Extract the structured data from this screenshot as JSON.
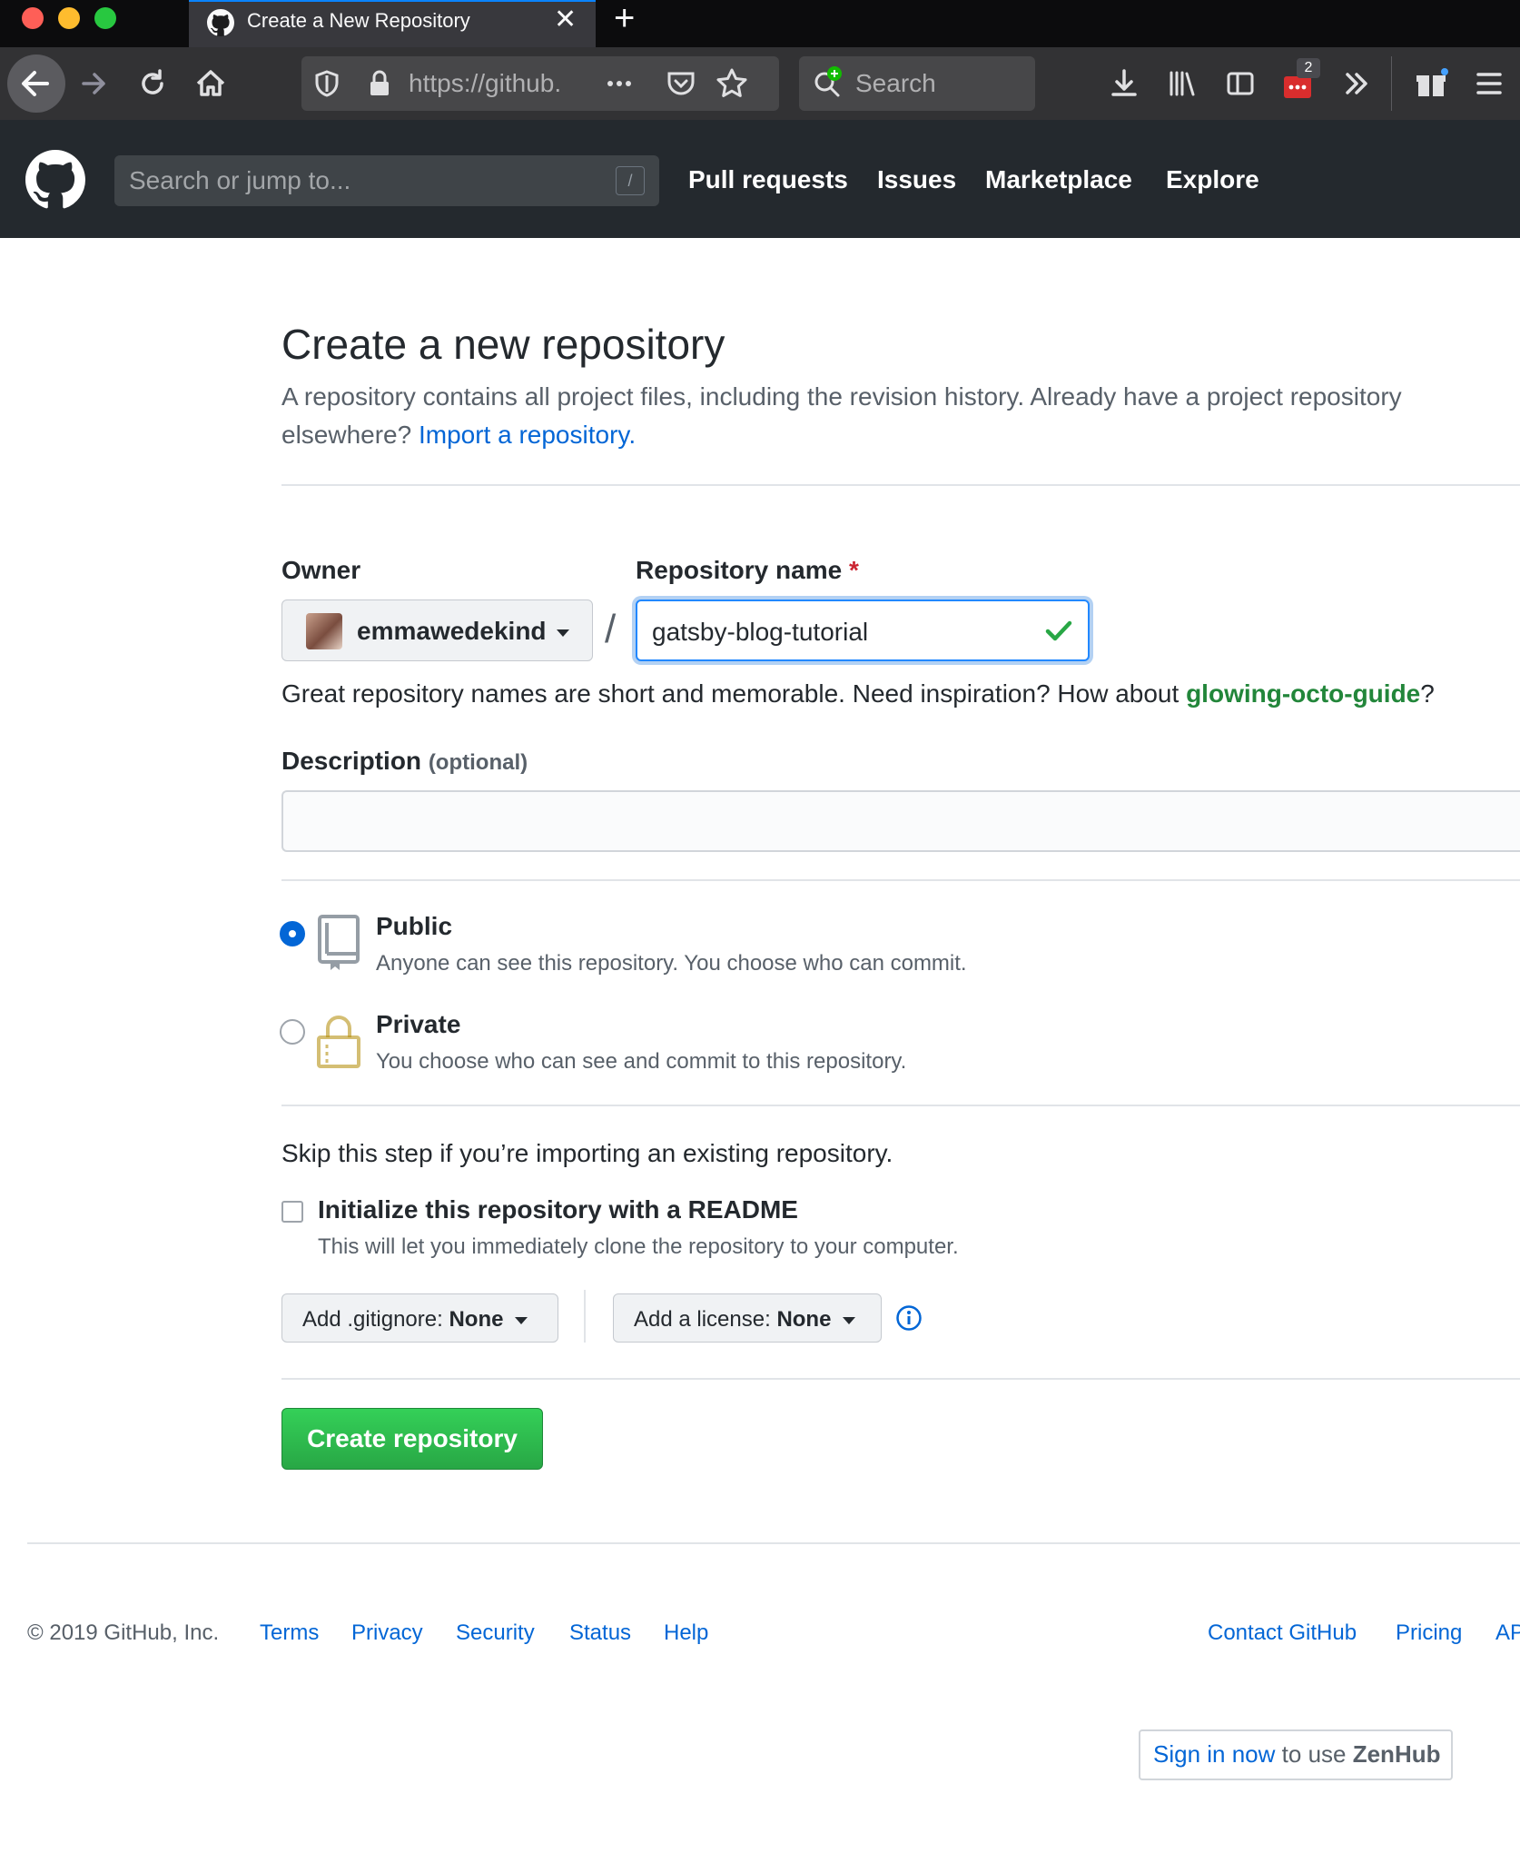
{
  "browser": {
    "tab_title": "Create a New Repository",
    "tab_close": "✕",
    "new_tab": "+",
    "url": "https://github.com/new",
    "url_visible": "https://github.",
    "search_placeholder": "Search",
    "extension_badge": "2"
  },
  "header": {
    "search_placeholder": "Search or jump to...",
    "search_shortcut": "/",
    "nav": [
      "Pull requests",
      "Issues",
      "Marketplace",
      "Explore"
    ]
  },
  "page": {
    "title": "Create a new repository",
    "subtitle_text": "A repository contains all project files, including the revision history. Already have a project repository elsewhere?",
    "import_link": "Import a repository."
  },
  "form": {
    "owner_label": "Owner",
    "owner_value": "emmawedekind",
    "separator": "/",
    "repo_name_label": "Repository name",
    "required_mark": "*",
    "repo_name_value": "gatsby-blog-tutorial",
    "hint_text": "Great repository names are short and memorable. Need inspiration? How about",
    "hint_suggestion": "glowing-octo-guide",
    "hint_end": "?",
    "description_label": "Description",
    "description_optional": "(optional)",
    "description_value": "",
    "visibility": {
      "selected": "public",
      "public_title": "Public",
      "public_desc": "Anyone can see this repository. You choose who can commit.",
      "private_title": "Private",
      "private_desc": "You choose who can see and commit to this repository."
    },
    "skip_text": "Skip this step if you’re importing an existing repository.",
    "readme_label": "Initialize this repository with a README",
    "readme_desc": "This will let you immediately clone the repository to your computer.",
    "readme_checked": false,
    "gitignore_label": "Add .gitignore:",
    "gitignore_value": "None",
    "license_label": "Add a license:",
    "license_value": "None",
    "create_button": "Create repository"
  },
  "footer": {
    "copyright": "© 2019 GitHub, Inc.",
    "left_links": [
      "Terms",
      "Privacy",
      "Security",
      "Status",
      "Help"
    ],
    "right_links": [
      "Contact GitHub",
      "Pricing",
      "AP"
    ]
  },
  "zenhub": {
    "link": "Sign in now",
    "middle": "to use",
    "brand": "ZenHub"
  },
  "colors": {
    "header_bg": "#24292e",
    "link": "#0366d6",
    "create_button": "#28a745",
    "suggestion": "#22863a",
    "focus_ring": "#2188ff"
  }
}
